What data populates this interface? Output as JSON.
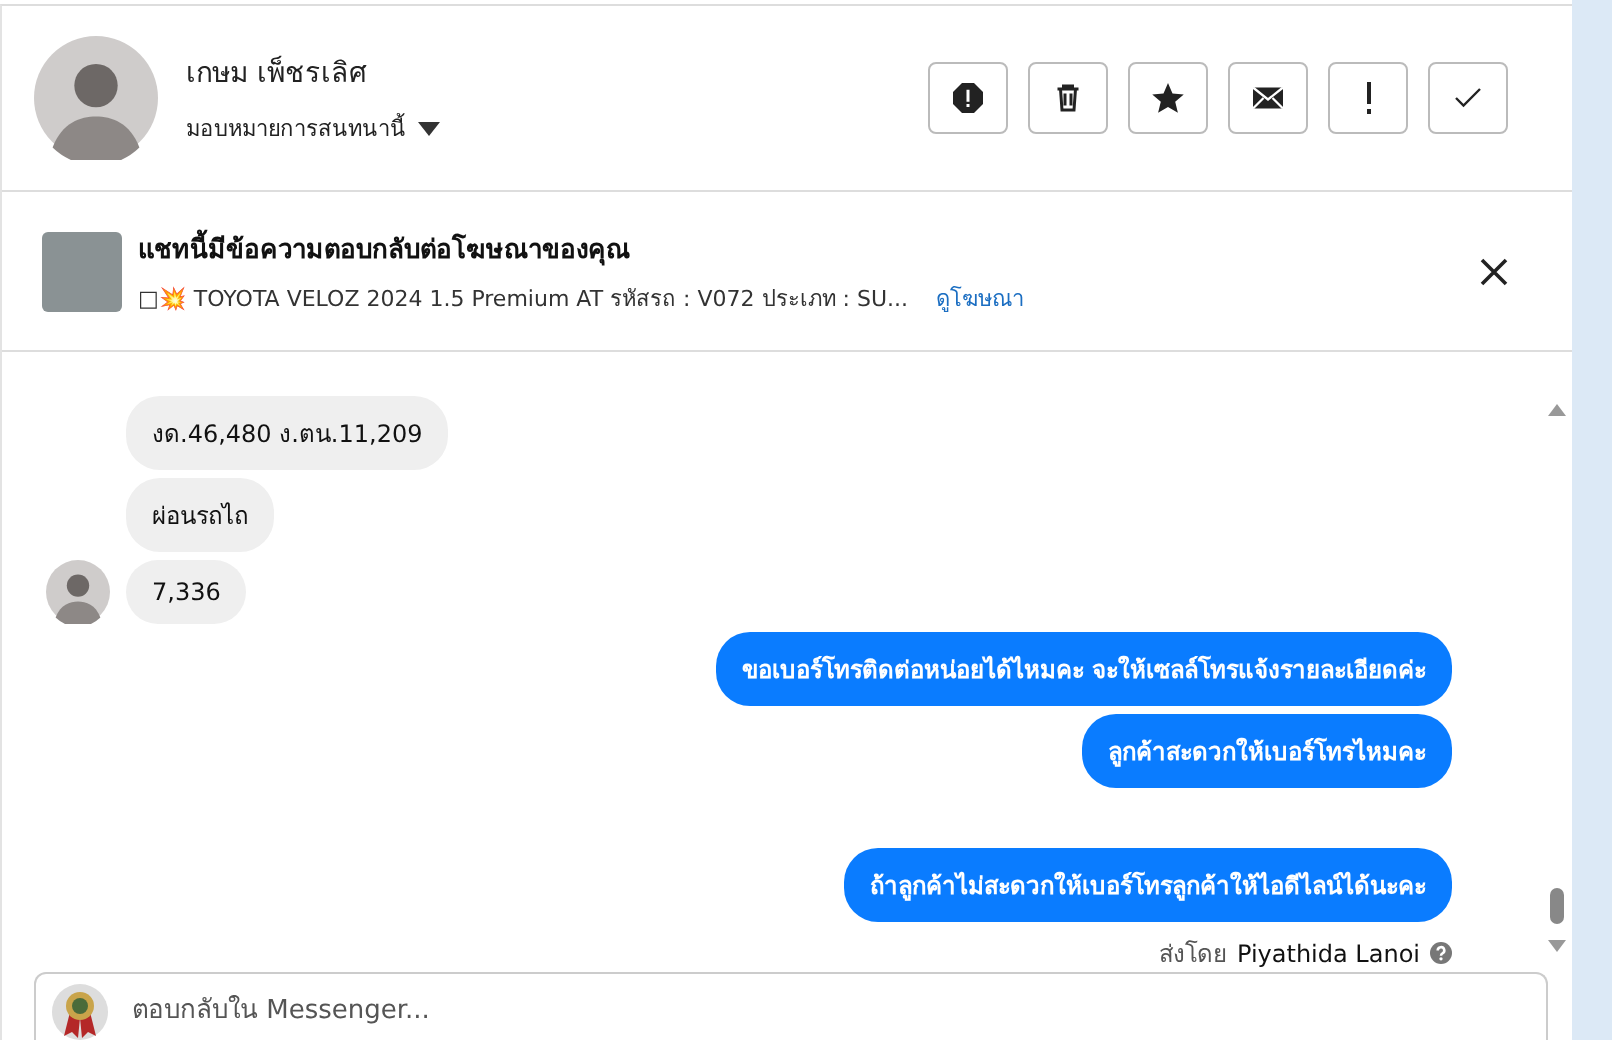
{
  "header": {
    "name": "เกษม เพ็ชรเลิศ",
    "assign_label": "มอบหมายการสนทนานี้",
    "actions": [
      {
        "kind": "alert"
      },
      {
        "kind": "trash"
      },
      {
        "kind": "star"
      },
      {
        "kind": "mail"
      },
      {
        "kind": "exclaim"
      },
      {
        "kind": "check"
      }
    ]
  },
  "ad_banner": {
    "title": "แชทนี้มีข้อความตอบกลับต่อโฆษณาของคุณ",
    "description": "□💥 TOYOTA VELOZ 2024 1.5 Premium AT รหัสรถ : V072 ประเภท : SU...",
    "link": "ดูโฆษณา"
  },
  "messages": [
    {
      "kind": "received",
      "text": "งด.46,480 ง.ตน.11,209",
      "avatar": false
    },
    {
      "kind": "received",
      "text": "ผ่อนรถไถ",
      "avatar": false
    },
    {
      "kind": "received",
      "text": "7,336",
      "avatar": true
    },
    {
      "kind": "sent",
      "text": "ขอเบอร์โทรติดต่อหน่อยได้ไหมคะ จะให้เซลล์โทรแจ้งรายละเอียดค่ะ"
    },
    {
      "kind": "sent",
      "text": "ลูกค้าสะดวกให้เบอร์โทรไหมคะ"
    },
    {
      "kind": "gap"
    },
    {
      "kind": "sent",
      "text": "ถ้าลูกค้าไม่สะดวกให้เบอร์โทรลูกค้าให้ไอดีไลน์ได้นะคะ"
    },
    {
      "kind": "sender",
      "prefix": "ส่งโดย",
      "name": "Piyathida Lanoi"
    }
  ],
  "composer": {
    "placeholder": "ตอบกลับใน Messenger..."
  }
}
